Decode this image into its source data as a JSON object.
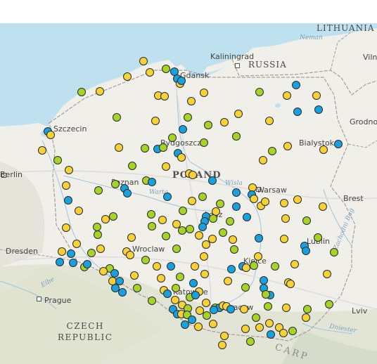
{
  "map": {
    "labels": {
      "countries": {
        "lithuania": "LITHUANIA",
        "russia": "RUSSIA",
        "poland": "POLAND",
        "czech_line1": "CZECH",
        "czech_line2": "REPUBLIC"
      },
      "cities": {
        "kaliningrad": "Kaliningrad",
        "gdansk": "Gdansk",
        "vilnius_partial": "Viln",
        "grodno": "Grodno",
        "szczecin": "Szczecin",
        "bydgoszcz": "Bydgoszcz",
        "bialystok": "Bialystok",
        "berlin": "Berlin",
        "poznan": "Poznan",
        "warsaw": "Warsaw",
        "brest": "Brest",
        "lodz": "Lodz",
        "lublin": "Lublin",
        "dresden": "Dresden",
        "wroclaw": "Wroclaw",
        "kielce": "Kielce",
        "krakow": "Kracow",
        "katowice": "Katowice",
        "prague": "Prague",
        "lviv": "Lviv"
      },
      "water": {
        "neman": "Neman",
        "wisla": "Wisla",
        "warta": "Warta",
        "elbe": "Elbe",
        "dniester": "Dniester",
        "zachodni_bug": "Zachodni Bug"
      },
      "mountain": "CARP"
    },
    "colors": {
      "yellow": "#f6d139",
      "green": "#a6d22a",
      "blue": "#1aa0dd",
      "sea": "#bfe1ef",
      "land": "#f1efe9"
    }
  }
}
